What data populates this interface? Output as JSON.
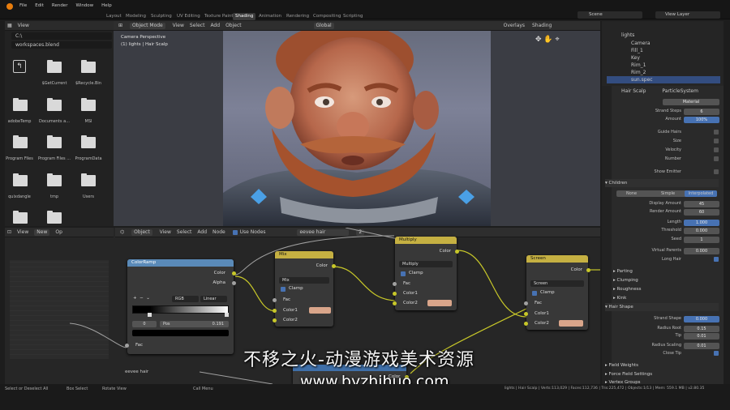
{
  "menubar": {
    "items": [
      "File",
      "Edit",
      "Render",
      "Window",
      "Help"
    ]
  },
  "workspace_tabs": [
    {
      "label": "Layout"
    },
    {
      "label": "Modeling"
    },
    {
      "label": "Sculpting"
    },
    {
      "label": "UV Editing"
    },
    {
      "label": "Texture Paint"
    },
    {
      "label": "Shading"
    },
    {
      "label": "Animation"
    },
    {
      "label": "Rendering"
    },
    {
      "label": "Compositing"
    },
    {
      "label": "Scripting"
    }
  ],
  "scene": {
    "label": "Scene"
  },
  "view_layer": {
    "label": "View Layer"
  },
  "file_browser": {
    "view_label": "View",
    "path": "C:\\",
    "filter": "workspaces.blend",
    "items": [
      {
        "label": ""
      },
      {
        "label": "$GetCurrent"
      },
      {
        "label": "$Recycle.Bin"
      },
      {
        "label": "adobeTemp"
      },
      {
        "label": "Documents a..."
      },
      {
        "label": "MSI"
      },
      {
        "label": "Program Files"
      },
      {
        "label": "Program Files ..."
      },
      {
        "label": "ProgramData"
      },
      {
        "label": "quixdangle"
      },
      {
        "label": "tmp"
      },
      {
        "label": "Users"
      },
      {
        "label": ""
      },
      {
        "label": ""
      }
    ]
  },
  "viewport": {
    "mode": "Object Mode",
    "menu": [
      "View",
      "Select",
      "Add",
      "Object"
    ],
    "transform": "Global",
    "overlays": "Overlays",
    "shading": "Shading",
    "info1": "Camera Perspective",
    "info2": "(1) lights | Hair Scalp"
  },
  "outliner": {
    "rows": [
      {
        "label": "lights"
      },
      {
        "label": "Camera"
      },
      {
        "label": "Fill_1"
      },
      {
        "label": "Key"
      },
      {
        "label": "Rim_1"
      },
      {
        "label": "Rim_2"
      },
      {
        "label": "sun.spec"
      }
    ]
  },
  "properties": {
    "breadcrumb1": "Hair Scalp",
    "breadcrumb2": "ParticleSystem",
    "color_label": "Color",
    "color_value": "Material",
    "strand_steps_label": "Strand Steps",
    "strand_steps": "6",
    "amount_label": "Amount",
    "amount": "100%",
    "guide_hairs": "Guide Hairs",
    "size": "Size",
    "velocity": "Velocity",
    "number": "Number",
    "show_emitter": "Show Emitter",
    "children": "Children",
    "child_modes": [
      "None",
      "Simple",
      "Interpolated"
    ],
    "display_amount_label": "Display Amount",
    "display_amount": "45",
    "render_amount_label": "Render Amount",
    "render_amount": "60",
    "length_label": "Length",
    "length": "1.000",
    "threshold_label": "Threshold",
    "threshold": "0.000",
    "seed_label": "Seed",
    "seed": "1",
    "virtual_parents_label": "Virtual Parents",
    "virtual_parents": "0.000",
    "long_hair": "Long Hair",
    "parting": "Parting",
    "clumping": "Clumping",
    "roughness": "Roughness",
    "kink": "Kink",
    "hair_shape": "Hair Shape",
    "strand_shape_label": "Strand Shape",
    "strand_shape": "0.000",
    "radius_root_label": "Radius Root",
    "radius_root": "0.15",
    "tip_label": "Tip",
    "tip": "0.01",
    "radius_scaling_label": "Radius Scaling",
    "radius_scaling": "0.01",
    "close_tip": "Close Tip",
    "field_weights": "Field Weights",
    "force_field": "Force Field Settings",
    "vertex_groups": "Vertex Groups"
  },
  "node_editor": {
    "left_header": {
      "view": "View",
      "new": "New",
      "open": "Op"
    },
    "header": {
      "object": "Object",
      "menu": [
        "View",
        "Select",
        "Add",
        "Node"
      ],
      "use_nodes": "Use Nodes",
      "material": "eevee hair",
      "users": "2"
    },
    "material_name": "eevee hair",
    "colorramp": {
      "title": "ColorRamp",
      "out1": "Color",
      "out2": "Alpha",
      "mode": "RGB",
      "interp": "Linear",
      "index": "0",
      "pos_label": "Pos",
      "pos": "0.191",
      "in": "Fac"
    },
    "mix": {
      "title": "Mix",
      "out": "Color",
      "blend": "Mix",
      "clamp": "Clamp",
      "fac": "Fac",
      "c1": "Color1",
      "c2": "Color2"
    },
    "multiply": {
      "title": "Multiply",
      "out": "Color",
      "blend": "Multiply",
      "clamp": "Clamp",
      "fac": "Fac",
      "c1": "Color1",
      "c2": "Color2"
    },
    "screen": {
      "title": "Screen",
      "out": "Color",
      "blend": "Screen",
      "clamp": "Clamp",
      "fac": "Fac",
      "c1": "Color1",
      "c2": "Color2"
    },
    "bottom_node": {
      "out": "Color"
    }
  },
  "statusbar": {
    "items": [
      "Select or Deselect All",
      "Box Select",
      "Rotate View",
      "Call Menu"
    ],
    "stats": "lights | Hair Scalp | Verts:113,029 | Faces:112,736 | Tris:225,472 | Objects:1/13 | Mem: 559.1 MB | v2.80.35"
  },
  "watermark": {
    "line1": "不移之火-动漫游戏美术资源",
    "line2": "www.byzhihuo.com"
  },
  "colors": {
    "accent": "#4772b3",
    "node_mix_header": "#c5b042",
    "node_ramp_header": "#5a8ab8",
    "swatch": "#d9a58a",
    "socket": "#c7c729"
  }
}
